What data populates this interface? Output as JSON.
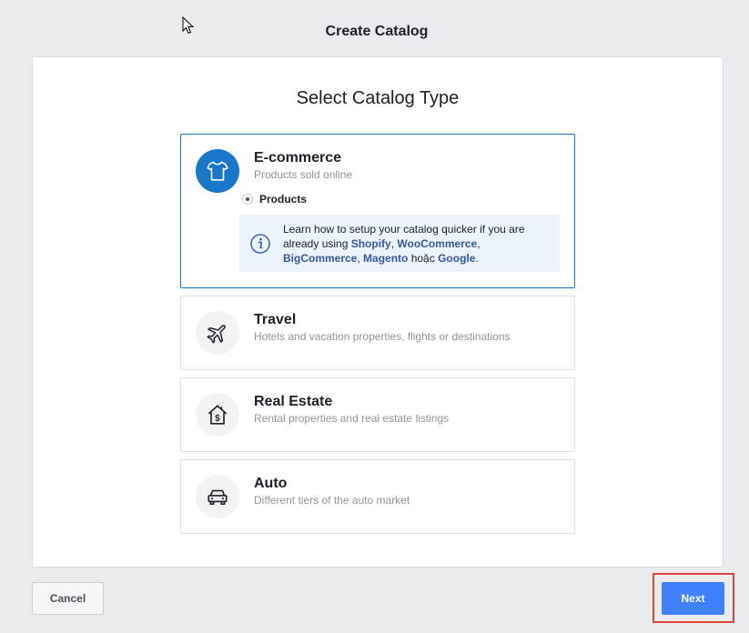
{
  "header": {
    "title": "Create Catalog"
  },
  "panel": {
    "heading": "Select Catalog Type"
  },
  "options": [
    {
      "title": "E-commerce",
      "subtitle": "Products sold online",
      "icon": "tshirt-icon",
      "selected": true,
      "radio_label": "Products",
      "info": {
        "line1": "Learn how to setup your catalog quicker if you are",
        "prefix": "already using ",
        "link_shopify": "Shopify",
        "sep1": ", ",
        "link_woocommerce": "WooCommerce",
        "sep2": ",",
        "link_bigcommerce": "BigCommerce",
        "sep3": ", ",
        "link_magento": "Magento",
        "connector": " hoặc ",
        "link_google": "Google",
        "end": "."
      }
    },
    {
      "title": "Travel",
      "subtitle": "Hotels and vacation properties, flights or destinations",
      "icon": "airplane-icon",
      "selected": false
    },
    {
      "title": "Real Estate",
      "subtitle": "Rental properties and real estate listings",
      "icon": "house-dollar-icon",
      "selected": false
    },
    {
      "title": "Auto",
      "subtitle": "Different tiers of the auto market",
      "icon": "car-icon",
      "selected": false
    }
  ],
  "footer": {
    "cancel_label": "Cancel",
    "next_label": "Next"
  },
  "colors": {
    "accent": "#1877c9",
    "next_button": "#4080ff",
    "highlight": "#e0453c",
    "info_bg": "#ecf3fd"
  }
}
